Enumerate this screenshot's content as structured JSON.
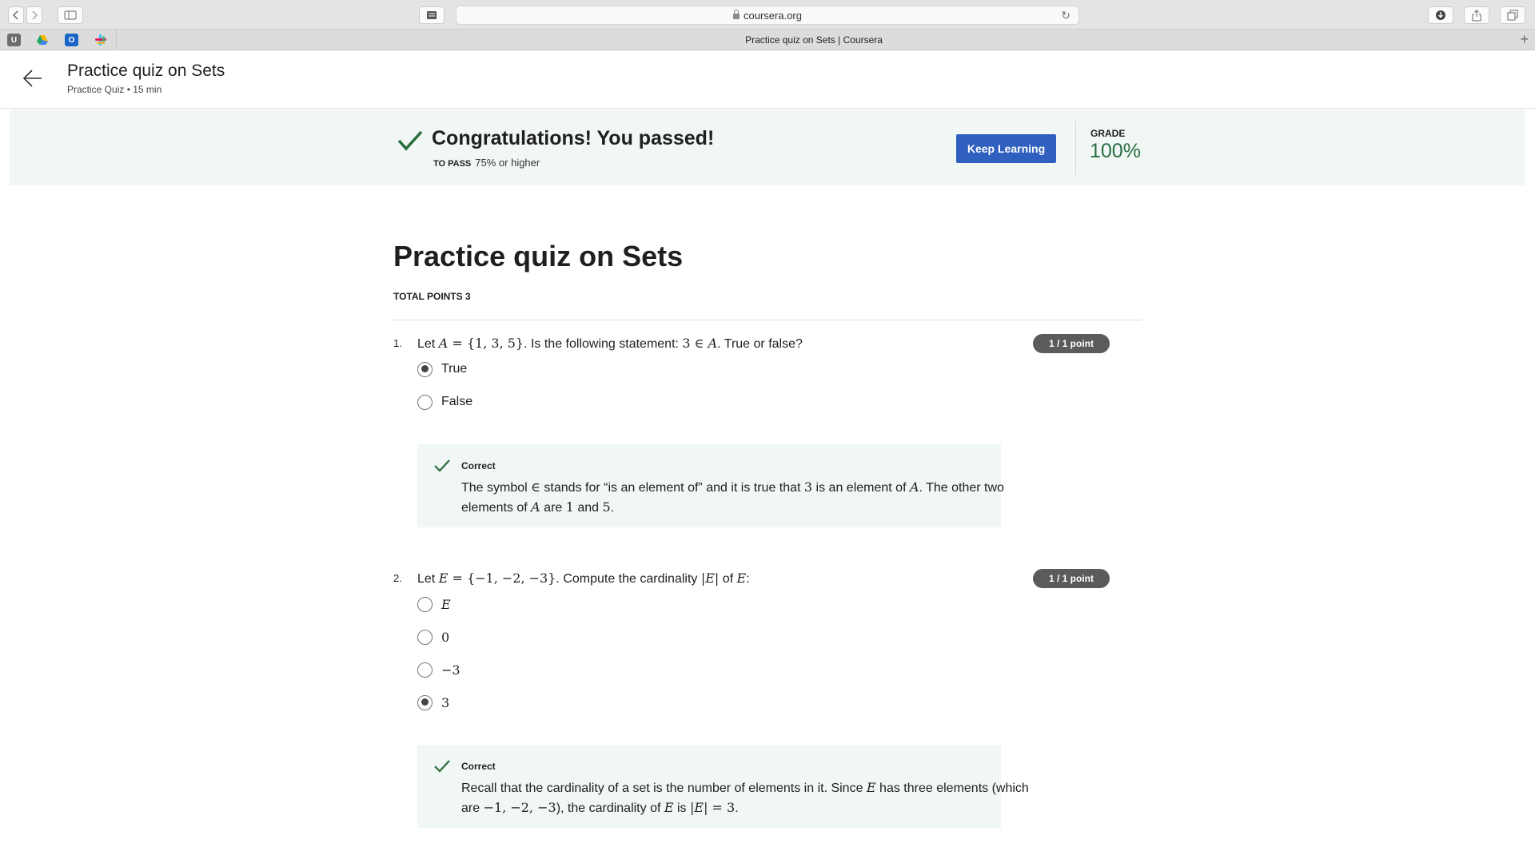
{
  "browser": {
    "url": "coursera.org",
    "tab_title": "Practice quiz on Sets | Coursera",
    "favicons": [
      "U",
      "drive",
      "O",
      "slack"
    ]
  },
  "header": {
    "title": "Practice quiz on Sets",
    "subtitle": "Practice Quiz • 15 min"
  },
  "banner": {
    "message": "Congratulations! You passed!",
    "to_pass_label": "TO PASS",
    "to_pass_value": "75% or higher",
    "button_label": "Keep Learning",
    "grade_label": "GRADE",
    "grade_value": "100%",
    "accent_color": "#2f5fbf",
    "success_color": "#2a6e3f"
  },
  "quiz": {
    "title": "Practice quiz on Sets",
    "total_points": "TOTAL POINTS 3",
    "questions": [
      {
        "number": "1.",
        "points": "1 / 1 point",
        "text": {
          "t1": "Let ",
          "m1": "A",
          "m2": " = {1, 3, 5}",
          "t2": ". Is the following statement: ",
          "m3": "3 ∈ ",
          "m4": "A",
          "t3": ". True or false?"
        },
        "options": [
          {
            "label": "True",
            "selected": true
          },
          {
            "label": "False",
            "selected": false
          }
        ],
        "feedback": {
          "heading": "Correct",
          "t1": "The symbol ",
          "m1": "∈",
          "t2": " stands for “is an element of” and it is true that ",
          "m2": "3",
          "t3": " is an element of ",
          "m3": "A",
          "t4": ". The other two elements of ",
          "m4": "A",
          "t5": " are ",
          "m5": "1",
          "t6": " and ",
          "m6": "5",
          "t7": "."
        }
      },
      {
        "number": "2.",
        "points": "1 / 1 point",
        "text": {
          "t1": "Let ",
          "m1": "E",
          "m2": " = {−1, −2, −3}",
          "t2": ". Compute the cardinality ",
          "m3": "|",
          "m4": "E",
          "m5": "|",
          "t3": " of ",
          "m6": "E",
          "t4": ":"
        },
        "options": [
          {
            "label": "E",
            "selected": false
          },
          {
            "label": "0",
            "selected": false
          },
          {
            "label": "−3",
            "selected": false
          },
          {
            "label": "3",
            "selected": true
          }
        ],
        "feedback": {
          "heading": "Correct",
          "t1": "Recall that the cardinality of a set is the number of elements in it. Since ",
          "m1": "E",
          "t2": " has three elements (which are ",
          "m2": "−1, −2, −3",
          "t3": "), the cardinality of ",
          "m3": "E",
          "t4": " is ",
          "m4": "|",
          "m5": "E",
          "m6": "| = 3",
          "t5": "."
        }
      }
    ]
  }
}
